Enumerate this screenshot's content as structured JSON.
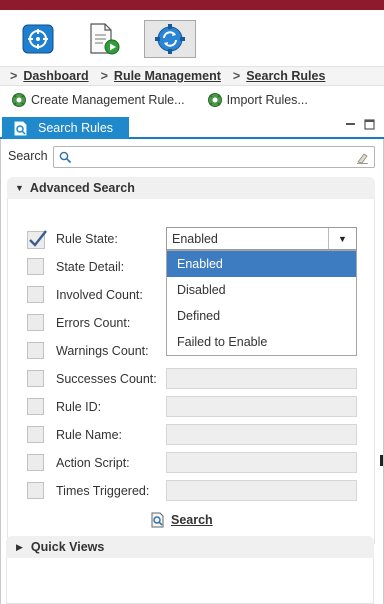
{
  "toolbar": {
    "buttons": [
      {
        "name": "dashboard",
        "icon": "dashboard-icon"
      },
      {
        "name": "documents",
        "icon": "document-play-icon"
      },
      {
        "name": "rules",
        "icon": "rules-sync-gear-icon",
        "active": true
      }
    ]
  },
  "breadcrumb": {
    "items": [
      "Dashboard",
      "Rule Management",
      "Search Rules"
    ]
  },
  "actions": {
    "create": "Create Management Rule...",
    "import": "Import Rules..."
  },
  "tab": {
    "label": "Search Rules"
  },
  "search": {
    "label": "Search",
    "value": "",
    "placeholder": ""
  },
  "advanced": {
    "title": "Advanced Search",
    "fields": [
      {
        "label": "Rule State:",
        "checked": true,
        "value": "Enabled"
      },
      {
        "label": "State Detail:",
        "checked": false,
        "value": ""
      },
      {
        "label": "Involved Count:",
        "checked": false,
        "value": ""
      },
      {
        "label": "Errors Count:",
        "checked": false,
        "value": ""
      },
      {
        "label": "Warnings Count:",
        "checked": false,
        "value": ""
      },
      {
        "label": "Successes Count:",
        "checked": false,
        "value": ""
      },
      {
        "label": "Rule ID:",
        "checked": false,
        "value": ""
      },
      {
        "label": "Rule Name:",
        "checked": false,
        "value": ""
      },
      {
        "label": "Action Script:",
        "checked": false,
        "value": ""
      },
      {
        "label": "Times Triggered:",
        "checked": false,
        "value": ""
      }
    ],
    "rule_state_options": [
      "Enabled",
      "Disabled",
      "Defined",
      "Failed to Enable"
    ],
    "rule_state_selected": "Enabled",
    "search_button": "Search"
  },
  "quick_views": {
    "title": "Quick Views"
  },
  "colors": {
    "topbar": "#8e1b2c",
    "tab_blue": "#1f89cc",
    "selected_option": "#3d7cc0"
  }
}
